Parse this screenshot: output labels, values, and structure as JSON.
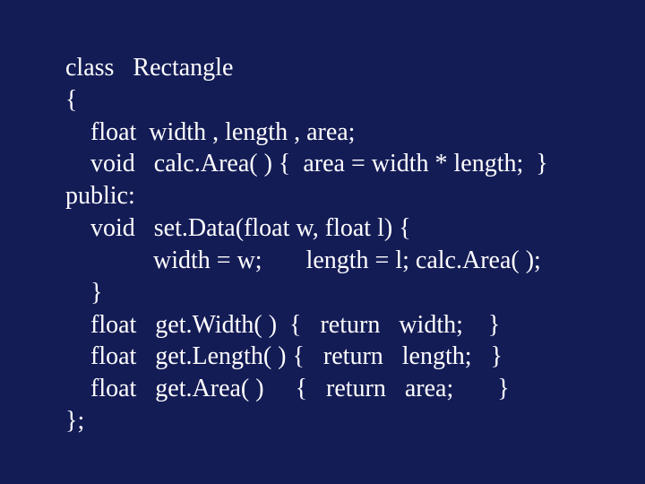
{
  "code": {
    "lines": [
      "class   Rectangle",
      "{",
      "    float  width , length , area;",
      "    void   calc.Area( ) {  area = width * length;  }",
      "public:",
      "    void   set.Data(float w, float l) {",
      "              width = w;       length = l; calc.Area( );",
      "    }",
      "    float   get.Width( )  {   return   width;    }",
      "    float   get.Length( ) {   return   length;   }",
      "    float   get.Area( )     {   return   area;       }",
      "};"
    ]
  }
}
